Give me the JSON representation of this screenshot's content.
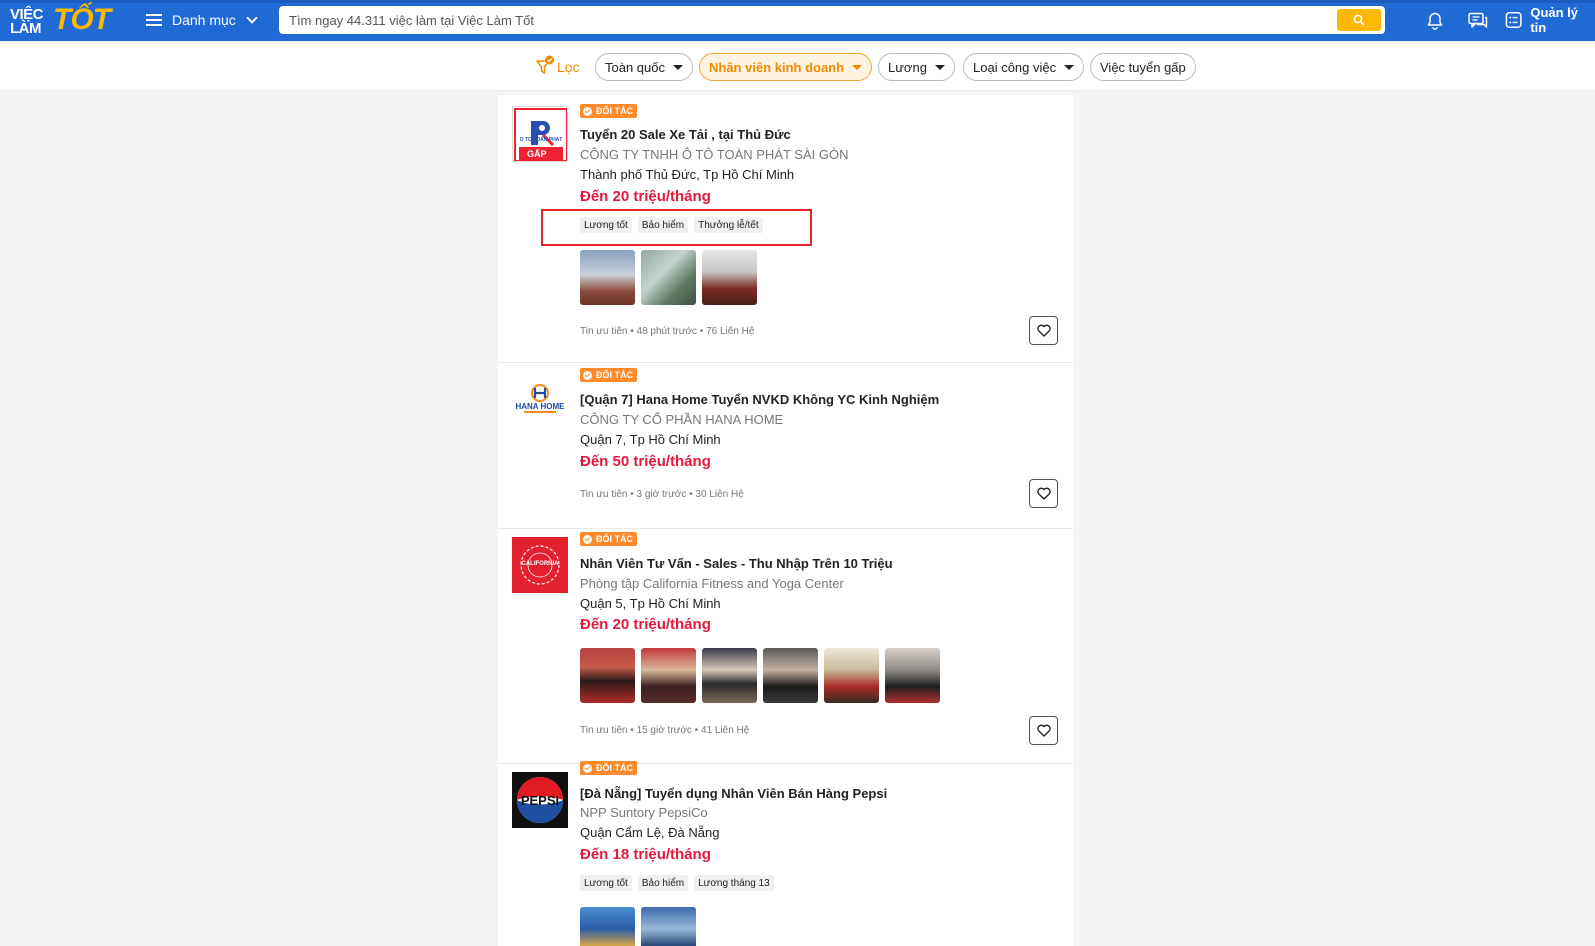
{
  "header": {
    "logo_line1": "VIỆC",
    "logo_line2": "LÀM",
    "logo_big": "TỐT",
    "menu_label": "Danh mục",
    "search_placeholder": "Tìm ngay 44.311 việc làm tại Việc Làm Tốt",
    "manage_label": "Quản lý tin"
  },
  "filters": {
    "filter_label": "Lọc",
    "chips": [
      {
        "label": "Toàn quốc",
        "dropdown": true,
        "active": false
      },
      {
        "label": "Nhân viên kinh doanh",
        "dropdown": true,
        "active": true
      },
      {
        "label": "Lương",
        "dropdown": true,
        "active": false
      },
      {
        "label": "Loại công việc",
        "dropdown": true,
        "active": false
      },
      {
        "label": "Việc tuyển gấp",
        "dropdown": false,
        "active": false
      }
    ]
  },
  "colors": {
    "brand_blue": "#1f6ad4",
    "accent_yellow": "#ffb800",
    "salary_red": "#e5193b",
    "badge_orange": "#ff8a2b",
    "highlight_red": "#e0262b"
  },
  "listings": [
    {
      "badge": "ĐỐI TÁC",
      "title": "Tuyển 20 Sale Xe Tải , tại Thủ Đức",
      "company": "CÔNG TY TNHH Ô TÔ TOÀN PHÁT SÀI GÒN",
      "location": "Thành phố Thủ Đức, Tp Hồ Chí Minh",
      "salary": "Đến 20 triệu/tháng",
      "tags": [
        "Lương tốt",
        "Bảo hiểm",
        "Thưởng lễ/tết"
      ],
      "logo_text": "Ô TÔ TOÀN PHÁT",
      "logo_badge": "GẤP",
      "meta": "Tin ưu tiên • 48 phút trước • 76 Liên Hệ"
    },
    {
      "badge": "ĐỐI TÁC",
      "title": "[Quận 7] Hana Home Tuyển NVKD Không YC Kinh Nghiệm",
      "company": "CÔNG TY CỔ PHẦN HANA HOME",
      "location": "Quận 7, Tp Hồ Chí Minh",
      "salary": "Đến 50 triệu/tháng",
      "tags": [],
      "logo_text": "HANA HOME",
      "meta": "Tin ưu tiên • 3 giờ trước • 30 Liên Hệ"
    },
    {
      "badge": "ĐỐI TÁC",
      "title": "Nhân Viên Tư Vấn - Sales - Thu Nhập Trên 10 Triệu",
      "company": "Phòng tập California Fitness and Yoga Center",
      "location": "Quận 5, Tp Hồ Chí Minh",
      "salary": "Đến 20 triệu/tháng",
      "tags": [],
      "logo_text": "CALIFORNIA",
      "meta": "Tin ưu tiên • 15 giờ trước • 41 Liên Hệ"
    },
    {
      "badge": "ĐỐI TÁC",
      "title": "[Đà Nẵng] Tuyển dụng Nhân Viên Bán Hàng Pepsi",
      "company": "NPP Suntory PepsiCo",
      "location": "Quận Cẩm Lệ, Đà Nẵng",
      "salary": "Đến 18 triệu/tháng",
      "tags": [
        "Lương tốt",
        "Bảo hiểm",
        "Lương tháng 13"
      ],
      "logo_text": "PEPSI"
    }
  ]
}
